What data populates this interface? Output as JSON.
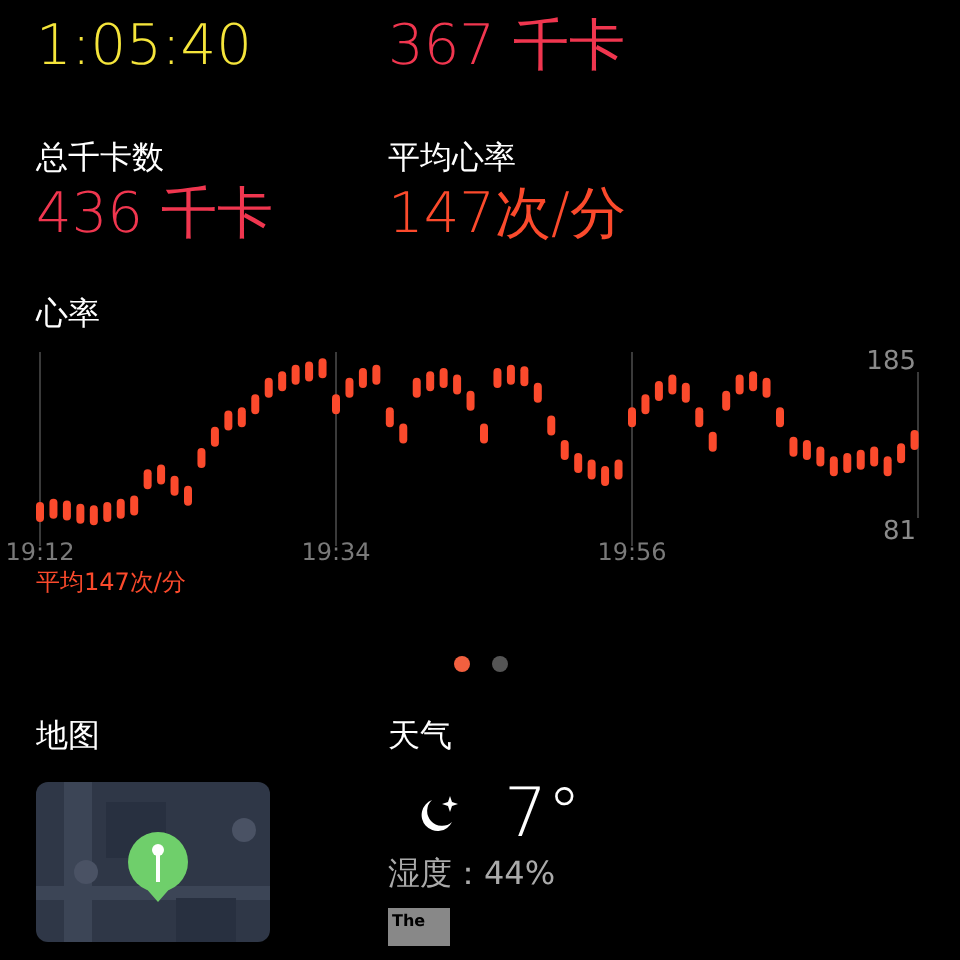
{
  "top_stats": [
    {
      "value": "1:05:40",
      "color": "#f5e53b"
    },
    {
      "value": "367 千卡",
      "color": "#f0364f"
    }
  ],
  "stats": [
    {
      "label": "总千卡数",
      "value": "436 千卡",
      "color": "#f0364f"
    },
    {
      "label": "平均心率",
      "value": "147次/分",
      "color": "#fb4a2c"
    }
  ],
  "heart_rate": {
    "title": "心率",
    "average": "平均147次/分",
    "chart_data": {
      "type": "scatter",
      "grid": true,
      "ylim": [
        81,
        185
      ],
      "yticks": [
        81,
        185
      ],
      "categories": [
        "19:12",
        null,
        null,
        null,
        null,
        null,
        null,
        null,
        null,
        null,
        null,
        null,
        null,
        null,
        null,
        null,
        null,
        null,
        null,
        null,
        null,
        null,
        "19:34",
        null,
        null,
        null,
        null,
        null,
        null,
        null,
        null,
        null,
        null,
        null,
        null,
        null,
        null,
        null,
        null,
        null,
        null,
        null,
        null,
        null,
        "19:56",
        null,
        null,
        null,
        null,
        null,
        null,
        null,
        null,
        null,
        null,
        null,
        null,
        null,
        null,
        null,
        null,
        null,
        null,
        null,
        null,
        null
      ],
      "series": [
        {
          "color": "#fb4a2c",
          "values": [
            92,
            94,
            93,
            91,
            90,
            92,
            94,
            96,
            112,
            115,
            108,
            102,
            125,
            138,
            148,
            150,
            158,
            168,
            172,
            176,
            178,
            180,
            158,
            168,
            174,
            176,
            150,
            140,
            168,
            172,
            174,
            170,
            160,
            140,
            174,
            176,
            175,
            165,
            145,
            130,
            122,
            118,
            114,
            118,
            150,
            158,
            166,
            170,
            165,
            150,
            135,
            160,
            170,
            172,
            168,
            150,
            132,
            130,
            126,
            120,
            122,
            124,
            126,
            120,
            128,
            136
          ]
        }
      ]
    }
  },
  "pages": [
    {
      "selected": true
    },
    {
      "selected": false
    }
  ],
  "map": {
    "title": "地图"
  },
  "weather": {
    "title": "天气",
    "temperature": "7°",
    "humidity": "湿度：44%",
    "source_logo": "The"
  }
}
